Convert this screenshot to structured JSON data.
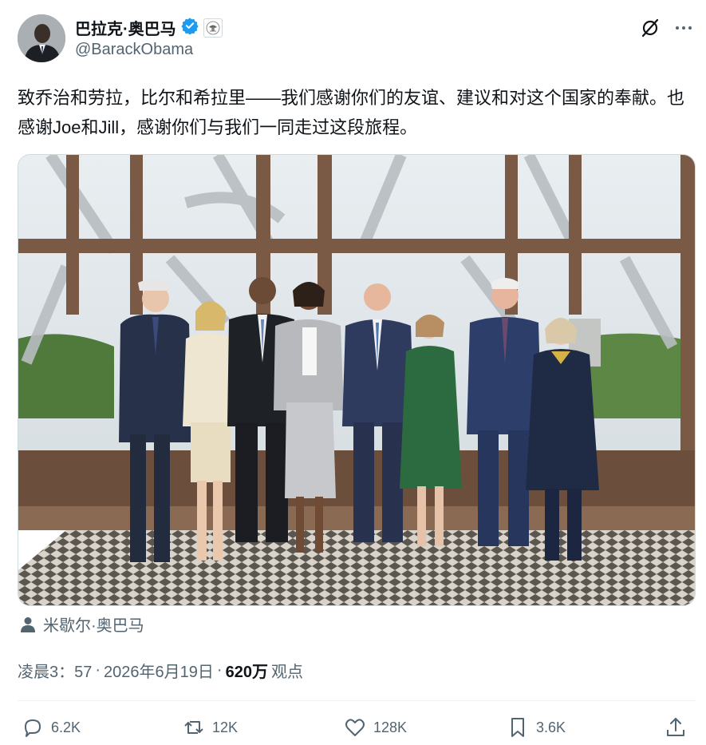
{
  "author": {
    "display_name": "巴拉克·奥巴马",
    "handle": "@BarackObama",
    "verified_icon": "verified-badge-icon",
    "affiliation_icon": "us-government-seal-icon"
  },
  "header_actions": {
    "grok_icon": "grok-icon",
    "more_icon": "more-options-icon"
  },
  "tweet": {
    "text": "致乔治和劳拉，比尔和希拉里——我们感谢你们的友谊、建议和对这个国家的奉献。也感谢Joe和Jill，感谢你们与我们一同走过这段旅程。"
  },
  "media": {
    "tagged_person": "米歇尔·奥巴马"
  },
  "meta": {
    "time": "凌晨3：57",
    "separator": "·",
    "date": "2026年6月19日",
    "views_count": "620万",
    "views_label": "观点"
  },
  "actions": {
    "reply_count": "6.2K",
    "retweet_count": "12K",
    "like_count": "128K",
    "bookmark_count": "3.6K"
  },
  "colors": {
    "verified": "#1d9bf0",
    "secondary_text": "#536471",
    "primary_text": "#0f1419"
  }
}
